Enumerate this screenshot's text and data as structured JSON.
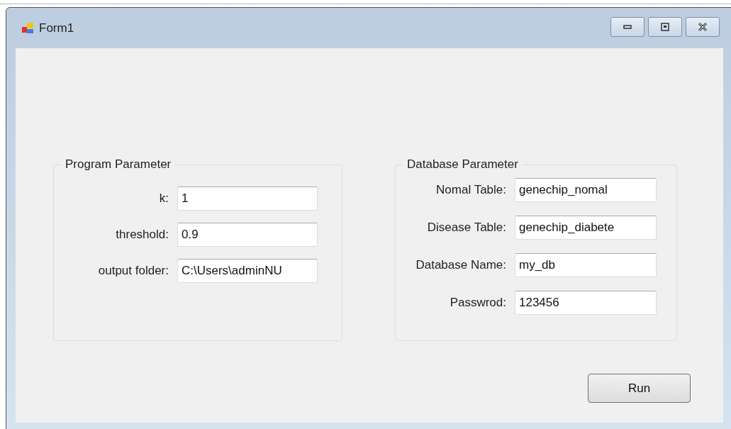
{
  "window": {
    "title": "Form1"
  },
  "groups": [
    {
      "title": "Program Parameter",
      "fields": [
        {
          "label": "k:",
          "value": "1"
        },
        {
          "label": "threshold:",
          "value": "0.9"
        },
        {
          "label": "output folder:",
          "value": "C:\\Users\\adminNU"
        }
      ]
    },
    {
      "title": "Database Parameter",
      "fields": [
        {
          "label": "Nomal Table:",
          "value": "genechip_nomal"
        },
        {
          "label": "Disease Table:",
          "value": "genechip_diabete"
        },
        {
          "label": "Database Name:",
          "value": "my_db"
        },
        {
          "label": "Passwrod:",
          "value": "123456"
        }
      ]
    }
  ],
  "buttons": [
    "Run"
  ]
}
